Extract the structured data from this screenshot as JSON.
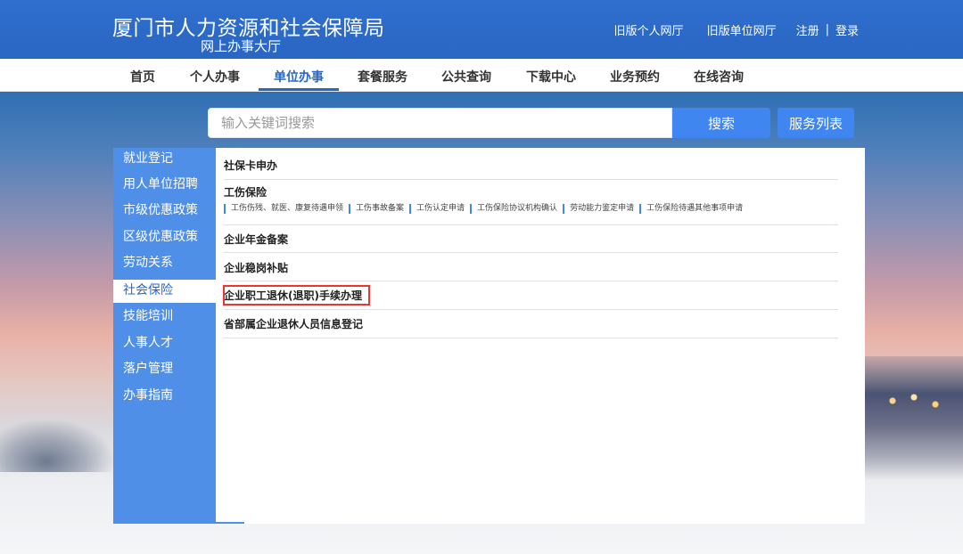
{
  "header": {
    "title": "厦门市人力资源和社会保障局",
    "subtitle": "网上办事大厅",
    "links": {
      "old_personal": "旧版个人网厅",
      "old_unit": "旧版单位网厅",
      "register": "注册",
      "separator": "|",
      "login": "登录"
    }
  },
  "nav": {
    "items": [
      "首页",
      "个人办事",
      "单位办事",
      "套餐服务",
      "公共查询",
      "下载中心",
      "业务预约",
      "在线咨询"
    ],
    "active_index": 2
  },
  "search": {
    "placeholder": "输入关键词搜索",
    "button": "搜索",
    "service_list": "服务列表"
  },
  "sidebar": {
    "items": [
      "就业登记",
      "用人单位招聘",
      "市级优惠政策",
      "区级优惠政策",
      "劳动关系",
      "社会保险",
      "技能培训",
      "人事人才",
      "落户管理",
      "办事指南"
    ],
    "active_index": 5
  },
  "content": {
    "rows": [
      {
        "title": "社保卡申办",
        "subs": []
      },
      {
        "title": "工伤保险",
        "subs": [
          "工伤伤残、就医、康复待遇申领",
          "工伤事故备案",
          "工伤认定申请",
          "工伤保险协议机构确认",
          "劳动能力鉴定申请",
          "工伤保险待遇其他事项申请"
        ]
      },
      {
        "title": "企业年金备案",
        "subs": []
      },
      {
        "title": "企业稳岗补贴",
        "subs": []
      },
      {
        "title": "企业职工退休(退职)手续办理",
        "subs": [],
        "highlighted": true
      },
      {
        "title": "省部属企业退休人员信息登记",
        "subs": []
      }
    ]
  },
  "colors": {
    "brand_blue": "#2a66c4",
    "button_blue": "#3f86f0",
    "sidebar_blue": "#4f8fe8",
    "highlight_red": "#e33333"
  }
}
